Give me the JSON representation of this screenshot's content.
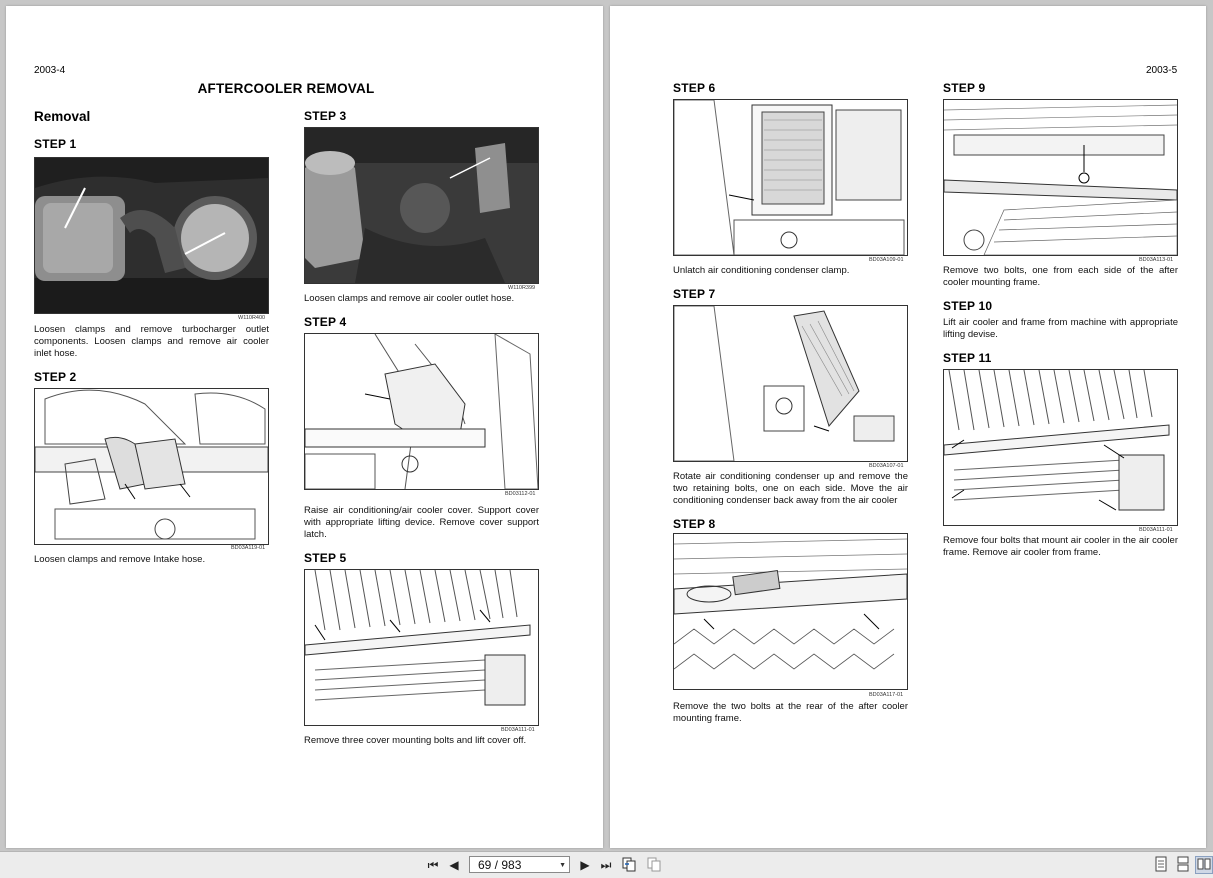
{
  "left_page": {
    "page_number": "2003-4",
    "title": "AFTERCOOLER REMOVAL",
    "section": "Removal",
    "steps": [
      {
        "label": "STEP 1",
        "figure_code": "W110R400",
        "caption": "Loosen clamps and remove turbocharger outlet components. Loosen clamps and remove air cooler inlet hose."
      },
      {
        "label": "STEP 2",
        "figure_code": "BD03A119-01",
        "caption": "Loosen clamps and remove Intake hose."
      },
      {
        "label": "STEP 3",
        "figure_code": "W110R399",
        "caption": "Loosen clamps and remove air cooler outlet hose."
      },
      {
        "label": "STEP 4",
        "figure_code": "BD03112-01",
        "caption": "Raise air conditioning/air cooler cover. Support cover with appropriate lifting device. Remove cover support latch."
      },
      {
        "label": "STEP 5",
        "figure_code": "BD03A111-01",
        "caption": "Remove three cover mounting bolts and lift cover off."
      }
    ]
  },
  "right_page": {
    "page_number": "2003-5",
    "steps": [
      {
        "label": "STEP 6",
        "figure_code": "BD03A109-01",
        "caption": "Unlatch air conditioning condenser clamp."
      },
      {
        "label": "STEP 7",
        "figure_code": "BD03A107-01",
        "caption": "Rotate air conditioning condenser up and remove the two retaining bolts, one on each side. Move the air conditioning condenser back away from the air cooler"
      },
      {
        "label": "STEP 8",
        "figure_code": "BD03A117-01",
        "caption": "Remove the two bolts at the rear of the after cooler mounting frame."
      },
      {
        "label": "STEP 9",
        "figure_code": "BD03A113-01",
        "caption": "Remove two bolts, one from each side of the after cooler mounting frame."
      },
      {
        "label": "STEP 10",
        "caption": "Lift air cooler and frame from machine with appropriate lifting devise."
      },
      {
        "label": "STEP 11",
        "figure_code": "BD03A111-01",
        "caption": "Remove four bolts that mount air cooler in the air cooler frame. Remove air cooler from frame."
      }
    ]
  },
  "toolbar": {
    "page_indicator": "69 / 983",
    "icons": [
      "first-page-icon",
      "previous-page-icon",
      "next-page-icon",
      "last-page-icon",
      "go-back-view-icon",
      "go-forward-view-icon",
      "single-page-icon",
      "continuous-page-icon",
      "facing-pages-icon"
    ]
  }
}
